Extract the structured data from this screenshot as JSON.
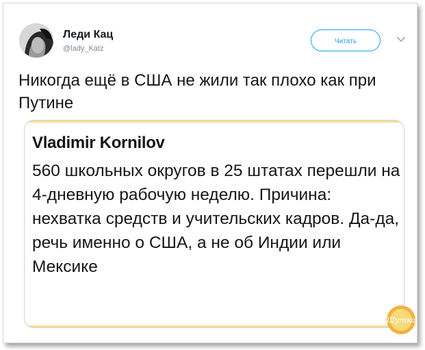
{
  "tweet": {
    "display_name": "Леди Кац",
    "handle": "@lady_Katz",
    "follow_label": "Читать",
    "text": "Никогда ещё в США не жили так плохо как при Путине"
  },
  "quote": {
    "author": "Vladimir Kornilov",
    "text": "560 школьных округов в 25 штатах перешли на 4-дневную рабочую неделю. Причина: нехватка средств и учительских кадров. Да-да, речь именно о США, а не об Индии или Мексике"
  },
  "watermark": {
    "text": "Шутка",
    "colors": {
      "outer": "#f3b13c",
      "inner": "#f8d97a"
    }
  },
  "colors": {
    "accent": "#1da1f2",
    "text": "#14171a",
    "muted": "#7b8791",
    "quote_bar": "#f7e08e"
  },
  "icons": {
    "avatar": "avatar-photo",
    "menu": "chevron-down-icon"
  }
}
